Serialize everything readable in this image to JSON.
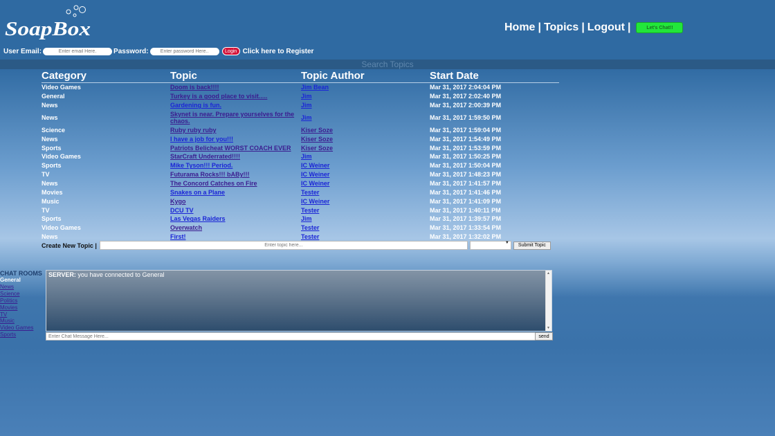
{
  "brand": {
    "logo_text": "SoapBox"
  },
  "nav": {
    "home": "Home",
    "topics": "Topics",
    "logout": "Logout",
    "separator": "|",
    "chat_button": "Let's Chat!!",
    "chat_button_color": "#22e63a"
  },
  "login": {
    "email_label": "User Email:",
    "email_placeholder": "Enter email Here.",
    "password_label": "Password:",
    "password_placeholder": "Enter password Here..",
    "login_button": "Login",
    "register_link": "Click here to Register"
  },
  "search": {
    "placeholder": "Search Topics"
  },
  "table": {
    "headers": {
      "category": "Category",
      "topic": "Topic",
      "author": "Topic Author",
      "date": "Start Date"
    },
    "rows": [
      {
        "category": "Video Games",
        "topic": "Doom is back!!!!",
        "author": "Jim Bean",
        "date": "Mar 31, 2017 2:04:04 PM"
      },
      {
        "category": "General",
        "topic": "Turkey is a good place to visit.....",
        "author": "Jim",
        "date": "Mar 31, 2017 2:02:40 PM"
      },
      {
        "category": "News",
        "topic": "Gardening is fun.",
        "author": "Jim",
        "date": "Mar 31, 2017 2:00:39 PM"
      },
      {
        "category": "News",
        "topic": "Skynet is near. Prepare yourselves for the chaos.",
        "author": "Jim",
        "date": "Mar 31, 2017 1:59:50 PM"
      },
      {
        "category": "Science",
        "topic": "Ruby ruby ruby",
        "author": "Kiser Soze",
        "date": "Mar 31, 2017 1:59:04 PM"
      },
      {
        "category": "News",
        "topic": "I have a job for you!!!",
        "author": "Kiser Soze",
        "date": "Mar 31, 2017 1:54:49 PM"
      },
      {
        "category": "Sports",
        "topic": "Patriots Belicheat WORST COACH EVER",
        "author": "Kiser Soze",
        "date": "Mar 31, 2017 1:53:59 PM"
      },
      {
        "category": "Video Games",
        "topic": "StarCraft Underrated!!!!",
        "author": "Jim",
        "date": "Mar 31, 2017 1:50:25 PM"
      },
      {
        "category": "Sports",
        "topic": "Mike Tyson!!! Period.",
        "author": "IC Weiner",
        "date": "Mar 31, 2017 1:50:04 PM"
      },
      {
        "category": "TV",
        "topic": "Futurama Rocks!!! bABy!!!",
        "author": "IC Weiner",
        "date": "Mar 31, 2017 1:48:23 PM"
      },
      {
        "category": "News",
        "topic": "The Concord Catches on Fire",
        "author": "IC Weiner",
        "date": "Mar 31, 2017 1:41:57 PM"
      },
      {
        "category": "Movies",
        "topic": "Snakes on a Plane",
        "author": "Tester",
        "date": "Mar 31, 2017 1:41:46 PM"
      },
      {
        "category": "Music",
        "topic": "Kygo",
        "author": "IC Weiner",
        "date": "Mar 31, 2017 1:41:09 PM"
      },
      {
        "category": "TV",
        "topic": "DCU TV",
        "author": "Tester",
        "date": "Mar 31, 2017 1:40:11 PM"
      },
      {
        "category": "Sports",
        "topic": "Las Vegas Raiders",
        "author": "Jim",
        "date": "Mar 31, 2017 1:39:57 PM"
      },
      {
        "category": "Video Games",
        "topic": "Overwatch",
        "author": "Tester",
        "date": "Mar 31, 2017 1:33:54 PM"
      },
      {
        "category": "News",
        "topic": "First!",
        "author": "Tester",
        "date": "Mar 31, 2017 1:32:02 PM"
      }
    ]
  },
  "create_topic": {
    "label": "Create New Topic |",
    "placeholder": "Enter topic here...",
    "select_value": "",
    "submit": "Submit Topic"
  },
  "chat": {
    "rooms_title": "CHAT ROOMS",
    "rooms": [
      "General",
      "News",
      "Science",
      "Politics",
      "Movies",
      "TV",
      "Music",
      "Video Games",
      "Sports"
    ],
    "active_room": "General",
    "messages": [
      {
        "sender": "SERVER:",
        "text": "you have connected to General"
      }
    ],
    "input_placeholder": "Enter Chat Message Here...",
    "send_button": "send"
  }
}
